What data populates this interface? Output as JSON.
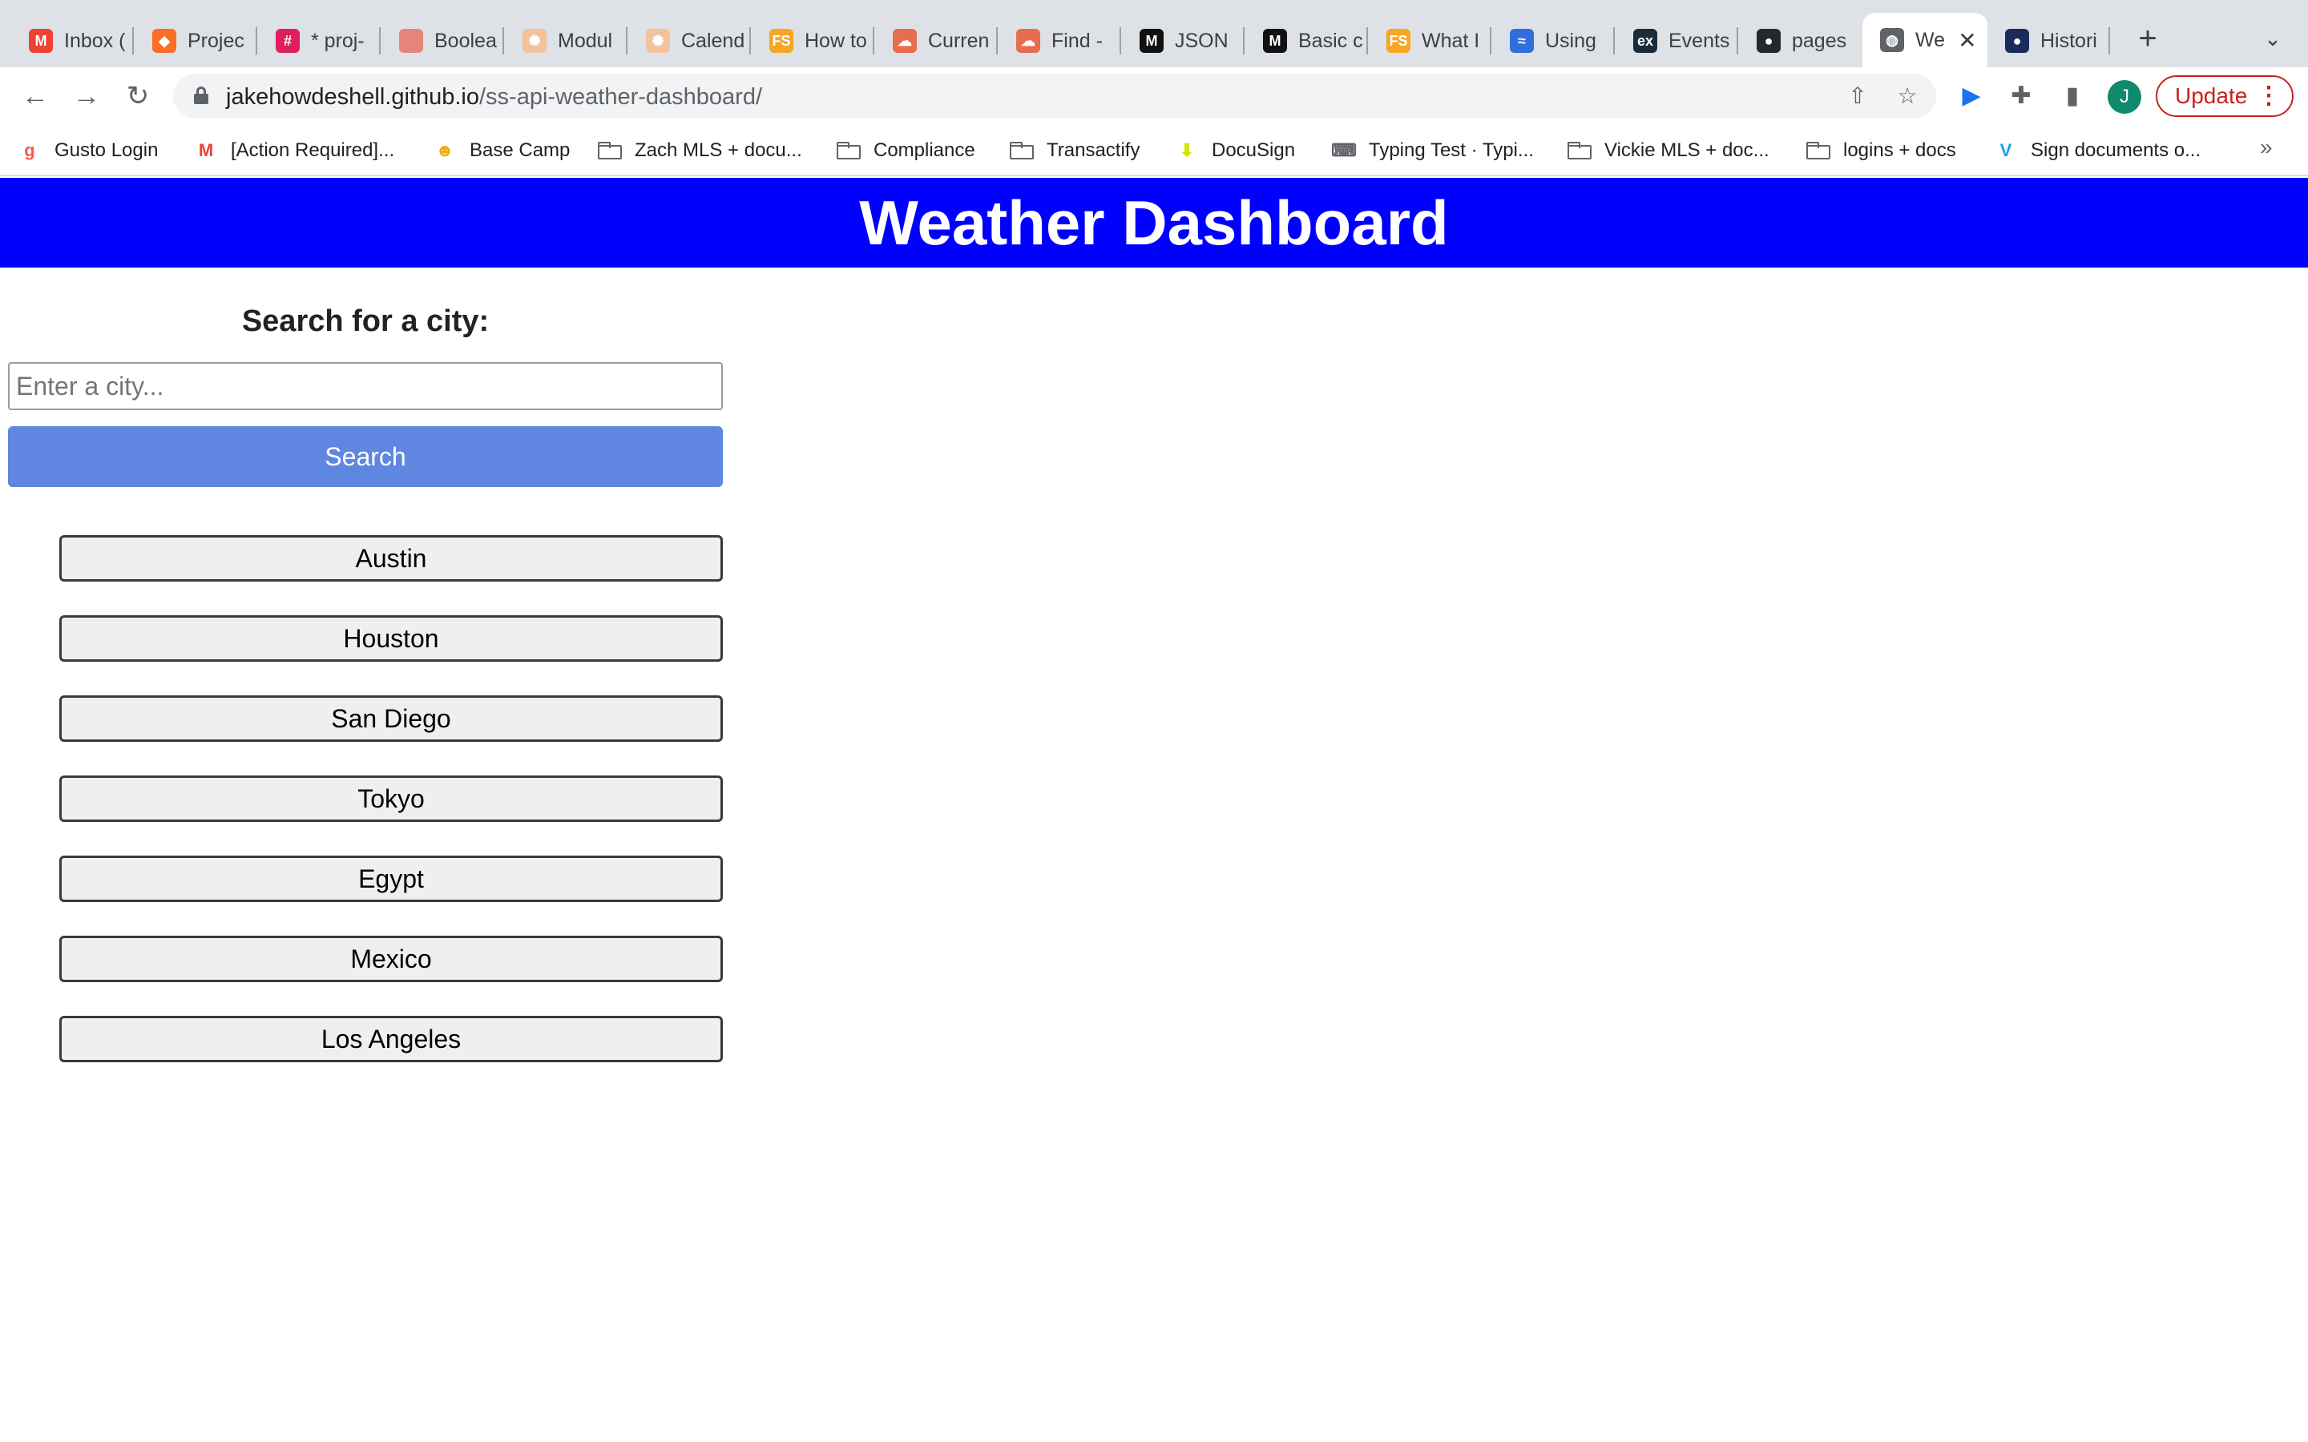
{
  "browser": {
    "tabs": [
      {
        "label": "Inbox (",
        "icon": "gmail-icon",
        "fav_text": "M",
        "fav_color": "#ea4335"
      },
      {
        "label": "Projec",
        "icon": "gitlab-icon",
        "fav_text": "◆",
        "fav_color": "#fc6d26"
      },
      {
        "label": "* proj-",
        "icon": "slack-icon",
        "fav_text": "#",
        "fav_color": "#e01e5a"
      },
      {
        "label": "Boolea",
        "icon": "dot-icon",
        "fav_text": "",
        "fav_color": "#e8837a"
      },
      {
        "label": "Modul",
        "icon": "compass-icon",
        "fav_text": "✺",
        "fav_color": "#f2c29b"
      },
      {
        "label": "Calend",
        "icon": "compass-icon",
        "fav_text": "✺",
        "fav_color": "#f2c29b"
      },
      {
        "label": "How to",
        "icon": "fs-icon",
        "fav_text": "FS",
        "fav_color": "#f6a623"
      },
      {
        "label": "Curren",
        "icon": "cloud-icon",
        "fav_text": "☁",
        "fav_color": "#e86c4f"
      },
      {
        "label": "Find -",
        "icon": "cloud-icon",
        "fav_text": "☁",
        "fav_color": "#e86c4f"
      },
      {
        "label": "JSON",
        "icon": "mdn-icon",
        "fav_text": "M",
        "fav_color": "#111111"
      },
      {
        "label": "Basic c",
        "icon": "mdn-icon",
        "fav_text": "M",
        "fav_color": "#111111"
      },
      {
        "label": "What I",
        "icon": "fs-icon",
        "fav_text": "FS",
        "fav_color": "#f6a623"
      },
      {
        "label": "Using",
        "icon": "wave-icon",
        "fav_text": "≈",
        "fav_color": "#2f6fdc"
      },
      {
        "label": "Events",
        "icon": "edx-icon",
        "fav_text": "ex",
        "fav_color": "#1b2b3a"
      },
      {
        "label": "pages",
        "icon": "github-icon",
        "fav_text": "●",
        "fav_color": "#24292e"
      },
      {
        "label": "We",
        "icon": "globe-icon",
        "fav_text": "◍",
        "fav_color": "#5f6368",
        "active": true
      },
      {
        "label": "Histori",
        "icon": "history-icon",
        "fav_text": "●",
        "fav_color": "#1a2a5a"
      }
    ],
    "close_glyph": "✕",
    "new_tab_glyph": "+",
    "tab_menu_glyph": "⌄",
    "url_host": "jakehowdeshell.github.io",
    "url_path": "/ss-api-weather-dashboard/",
    "avatar_initial": "J",
    "update_label": "Update",
    "bookmarks": [
      {
        "label": "Gusto Login",
        "icon": "gusto-icon",
        "glyph": "g",
        "color": "#f45d48"
      },
      {
        "label": "[Action Required]...",
        "icon": "gmail-icon",
        "glyph": "M",
        "color": "#ea4335"
      },
      {
        "label": "Base Camp",
        "icon": "basecamp-icon",
        "glyph": "☻",
        "color": "#f2a900"
      },
      {
        "label": "Zach MLS + docu...",
        "icon": "folder-icon",
        "glyph": "",
        "color": "#5f6368"
      },
      {
        "label": "Compliance",
        "icon": "folder-icon",
        "glyph": "",
        "color": "#5f6368"
      },
      {
        "label": "Transactify",
        "icon": "folder-icon",
        "glyph": "",
        "color": "#5f6368"
      },
      {
        "label": "DocuSign",
        "icon": "docusign-icon",
        "glyph": "⬇",
        "color": "#d5e600"
      },
      {
        "label": "Typing Test · Typi...",
        "icon": "typewriter-icon",
        "glyph": "⌨",
        "color": "#5f6368"
      },
      {
        "label": "Vickie MLS + doc...",
        "icon": "folder-icon",
        "glyph": "",
        "color": "#5f6368"
      },
      {
        "label": "logins + docs",
        "icon": "folder-icon",
        "glyph": "",
        "color": "#5f6368"
      },
      {
        "label": "Sign documents o...",
        "icon": "sign-icon",
        "glyph": "V",
        "color": "#1fa0e0"
      }
    ],
    "bookmarks_more": "»"
  },
  "app": {
    "title": "Weather Dashboard",
    "banner_color": "#0000ff",
    "search": {
      "heading": "Search for a city:",
      "placeholder": "Enter a city...",
      "value": "",
      "button_label": "Search",
      "button_color": "#5f87e2"
    },
    "history": [
      "Austin",
      "Houston",
      "San Diego",
      "Tokyo",
      "Egypt",
      "Mexico",
      "Los Angeles"
    ]
  }
}
